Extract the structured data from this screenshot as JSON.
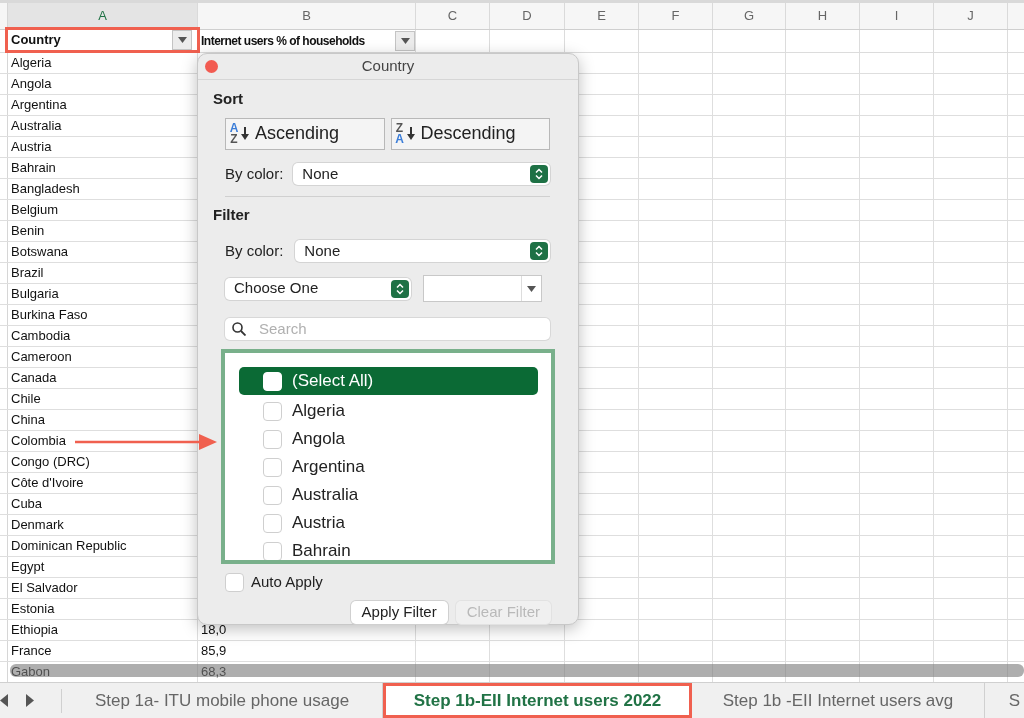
{
  "columns": [
    {
      "letter": "A",
      "selected": true
    },
    {
      "letter": "B",
      "selected": false
    },
    {
      "letter": "C",
      "selected": false
    },
    {
      "letter": "D",
      "selected": false
    },
    {
      "letter": "E",
      "selected": false
    },
    {
      "letter": "F",
      "selected": false
    },
    {
      "letter": "G",
      "selected": false
    },
    {
      "letter": "H",
      "selected": false
    },
    {
      "letter": "I",
      "selected": false
    },
    {
      "letter": "J",
      "selected": false
    }
  ],
  "header_row": [
    {
      "text": "Country",
      "highlighted": true
    },
    {
      "text": "Internet users % of households",
      "highlighted": false
    }
  ],
  "rows": [
    {
      "country": "Algeria"
    },
    {
      "country": "Angola"
    },
    {
      "country": "Argentina"
    },
    {
      "country": "Australia"
    },
    {
      "country": "Austria"
    },
    {
      "country": "Bahrain"
    },
    {
      "country": "Bangladesh"
    },
    {
      "country": "Belgium"
    },
    {
      "country": "Benin"
    },
    {
      "country": "Botswana"
    },
    {
      "country": "Brazil"
    },
    {
      "country": "Bulgaria"
    },
    {
      "country": "Burkina Faso"
    },
    {
      "country": "Cambodia"
    },
    {
      "country": "Cameroon"
    },
    {
      "country": "Canada"
    },
    {
      "country": "Chile"
    },
    {
      "country": "China"
    },
    {
      "country": "Colombia",
      "pointed": true
    },
    {
      "country": "Congo (DRC)"
    },
    {
      "country": "Côte d'Ivoire"
    },
    {
      "country": "Cuba"
    },
    {
      "country": "Denmark"
    },
    {
      "country": "Dominican Republic"
    },
    {
      "country": "Egypt"
    },
    {
      "country": "El Salvador"
    },
    {
      "country": "Estonia"
    },
    {
      "country": "Ethiopia",
      "value": "18,0"
    },
    {
      "country": "France",
      "value": "85,9"
    },
    {
      "country": "Gabon",
      "value": "68,3"
    }
  ],
  "filter_popup": {
    "title": "Country",
    "sort": {
      "heading": "Sort",
      "buttons": [
        {
          "kind": "ascending",
          "label": "Ascending",
          "letters": [
            "A",
            "Z"
          ]
        },
        {
          "kind": "descending",
          "label": "Descending",
          "letters": [
            "Z",
            "A"
          ]
        }
      ],
      "by_color_label": "By color:",
      "by_color_value": "None"
    },
    "filter": {
      "heading": "Filter",
      "by_color_label": "By color:",
      "by_color_value": "None",
      "condition": "Choose One",
      "search_placeholder": "Search",
      "items": [
        {
          "label": "(Select All)",
          "checked": false,
          "selected": true
        },
        {
          "label": "Algeria",
          "checked": false,
          "selected": false
        },
        {
          "label": "Angola",
          "checked": false,
          "selected": false
        },
        {
          "label": "Argentina",
          "checked": false,
          "selected": false
        },
        {
          "label": "Australia",
          "checked": false,
          "selected": false
        },
        {
          "label": "Austria",
          "checked": false,
          "selected": false
        },
        {
          "label": "Bahrain",
          "checked": false,
          "selected": false
        }
      ],
      "auto_apply": {
        "label": "Auto Apply",
        "checked": false
      },
      "apply_button": {
        "label": "Apply Filter",
        "disabled": false
      },
      "clear_button": {
        "label": "Clear Filter",
        "disabled": true
      }
    }
  },
  "sheet_tabs": [
    {
      "label": "Step 1a- ITU mobile phone usage",
      "selected": false,
      "highlighted": false
    },
    {
      "label": "Step 1b-EII Internet users 2022",
      "selected": true,
      "highlighted": true
    },
    {
      "label": "Step 1b -EII Internet users avg",
      "selected": false,
      "highlighted": false
    },
    {
      "label": "S",
      "selected": false,
      "highlighted": false
    }
  ]
}
